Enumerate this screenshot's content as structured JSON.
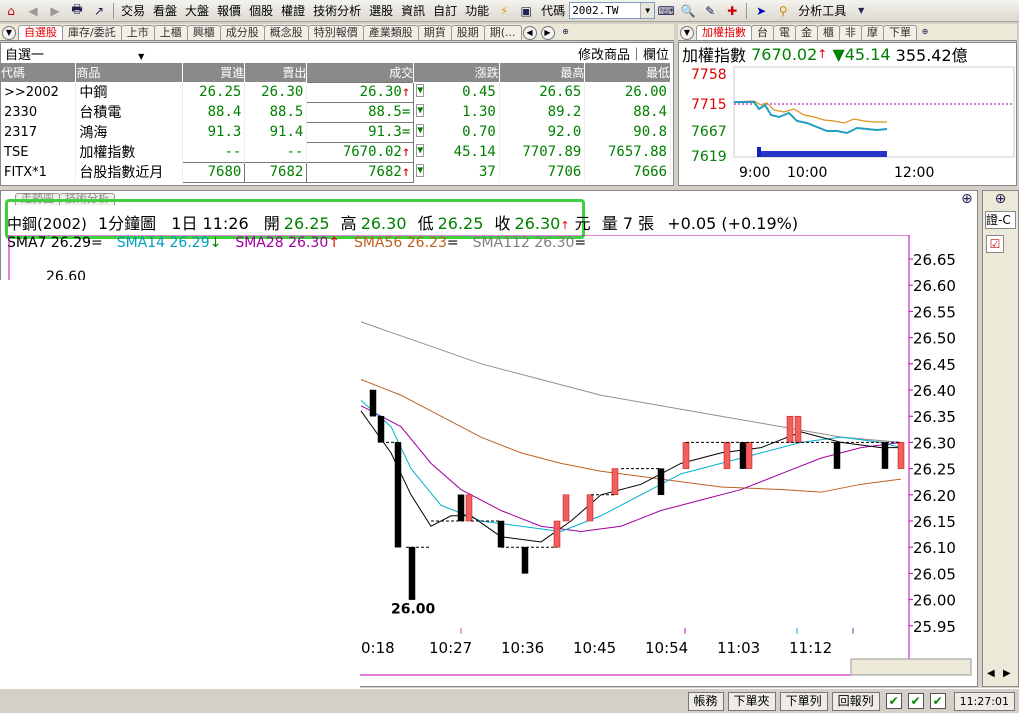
{
  "toolbar": {
    "menus": [
      "交易",
      "看盤",
      "大盤",
      "報價",
      "個股",
      "權證",
      "技術分析",
      "選股",
      "資訊",
      "自訂",
      "功能"
    ],
    "code_label": "代碼",
    "code_value": "2002.TW",
    "analysis_tools": "分析工具"
  },
  "quote": {
    "tabs": [
      "自選股",
      "庫存/委託",
      "上市",
      "上櫃",
      "興櫃",
      "成分股",
      "概念股",
      "特別報價",
      "產業類股",
      "期貨",
      "股期",
      "期(..."
    ],
    "watchlist": "自選一",
    "modify": "修改商品",
    "column": "欄位",
    "headers": [
      "代碼",
      "商品",
      "買進",
      "賣出",
      "成交",
      "漲跌",
      "最高",
      "最低"
    ],
    "rows": [
      {
        "code": ">>2002",
        "name": "中鋼",
        "bid": "26.25",
        "ask": "26.30",
        "last": "26.30",
        "last_mark": "↑",
        "chg": "0.45",
        "high": "26.65",
        "low": "26.00"
      },
      {
        "code": "2330",
        "name": "台積電",
        "bid": "88.4",
        "ask": "88.5",
        "last": "88.5",
        "last_mark": "=",
        "chg": "1.30",
        "high": "89.2",
        "low": "88.4"
      },
      {
        "code": "2317",
        "name": "鴻海",
        "bid": "91.3",
        "ask": "91.4",
        "last": "91.3",
        "last_mark": "=",
        "chg": "0.70",
        "high": "92.0",
        "low": "90.8"
      },
      {
        "code": "TSE",
        "name": "加權指數",
        "bid": "--",
        "ask": "--",
        "last": "7670.02",
        "last_mark": "↑",
        "chg": "45.14",
        "high": "7707.89",
        "low": "7657.88"
      },
      {
        "code": "FITX*1",
        "name": "台股指數近月",
        "bid": "7680",
        "ask": "7682",
        "last": "7682",
        "last_mark": "↑",
        "chg": "37",
        "high": "7706",
        "low": "7666"
      }
    ]
  },
  "index": {
    "tabs": [
      "加權指數",
      "台",
      "電",
      "金",
      "櫃",
      "非",
      "摩",
      "下單"
    ],
    "name": "加權指數",
    "value": "7670.02",
    "change": "45.14",
    "volume": "355.42億",
    "yticks": [
      "7758",
      "7715",
      "7667",
      "7619"
    ],
    "xticks": [
      "9:00",
      "10:00",
      "12:00"
    ]
  },
  "chart": {
    "tabs": [
      "走勢圖",
      "技術分析"
    ],
    "info": {
      "symbol": "中鋼(2002)",
      "period": "1分鐘圖",
      "day": "1日 11:26",
      "open_label": "開",
      "open": "26.25",
      "high_label": "高",
      "high": "26.30",
      "low_label": "低",
      "low": "26.25",
      "close_label": "收",
      "close": "26.30",
      "unit": "元",
      "vol_label": "量",
      "vol": "7",
      "vol_unit": "張",
      "change": "+0.05 (+0.19%)"
    },
    "sma": [
      {
        "label": "SMA7 26.29",
        "mark": "=",
        "color": "#000000"
      },
      {
        "label": "SMA14 26.29",
        "mark": "↓",
        "color": "#00a0c0"
      },
      {
        "label": "SMA28 26.30",
        "mark": "↑",
        "color": "#a000a0"
      },
      {
        "label": "SMA56 26.23",
        "mark": "=",
        "color": "#c06020"
      },
      {
        "label": "SMA112 26.30",
        "mark": "=",
        "color": "#808080"
      }
    ],
    "partial_label": "26.60",
    "low_label": "26.00",
    "yticks": [
      "26.65",
      "26.60",
      "26.55",
      "26.50",
      "26.45",
      "26.40",
      "26.35",
      "26.30",
      "26.25",
      "26.20",
      "26.15",
      "26.10",
      "26.05",
      "26.00",
      "25.95"
    ],
    "xticks": [
      "0:18",
      "10:27",
      "10:36",
      "10:45",
      "10:54",
      "11:03",
      "11:12"
    ]
  },
  "right_panel": {
    "text": "證-C"
  },
  "status": {
    "buttons": [
      "帳務",
      "下單夾",
      "下單列",
      "回報列"
    ],
    "time": "11:27:01"
  }
}
